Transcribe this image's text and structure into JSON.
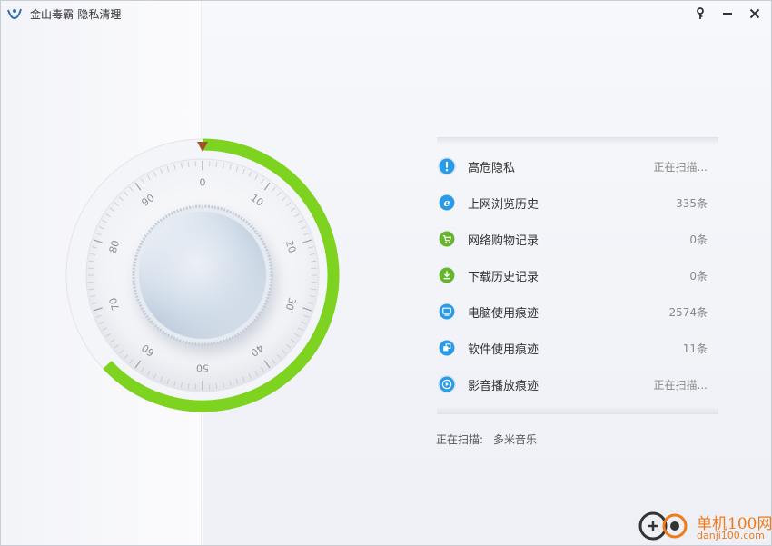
{
  "window": {
    "title": "金山毒霸-隐私清理",
    "logo_icon": "kingsoft-logo-icon",
    "buttons": {
      "key": "key-icon",
      "minimize": "minimize-icon",
      "close": "close-icon"
    }
  },
  "dial": {
    "ticks": [
      "0",
      "10",
      "20",
      "30",
      "40",
      "50",
      "60",
      "70",
      "80",
      "90"
    ],
    "progress": 0.63,
    "progress_color": "#7ed321",
    "pointer_color": "#a0522d"
  },
  "list": {
    "items": [
      {
        "label": "高危隐私",
        "status": "正在扫描...",
        "icon": "exclamation-icon",
        "color": "#2b9be8"
      },
      {
        "label": "上网浏览历史",
        "status": "335条",
        "icon": "ie-icon",
        "color": "#2b9be8"
      },
      {
        "label": "网络购物记录",
        "status": "0条",
        "icon": "cart-icon",
        "color": "#67b52f"
      },
      {
        "label": "下载历史记录",
        "status": "0条",
        "icon": "download-icon",
        "color": "#67b52f"
      },
      {
        "label": "电脑使用痕迹",
        "status": "2574条",
        "icon": "monitor-icon",
        "color": "#2b9be8"
      },
      {
        "label": "软件使用痕迹",
        "status": "11条",
        "icon": "software-icon",
        "color": "#2b9be8"
      },
      {
        "label": "影音播放痕迹",
        "status": "正在扫描...",
        "icon": "play-icon",
        "color": "#2b9be8"
      }
    ]
  },
  "scan": {
    "label": "正在扫描:",
    "target": "多米音乐"
  },
  "watermark": {
    "brand": "单机100网",
    "url": "danji100.com"
  }
}
